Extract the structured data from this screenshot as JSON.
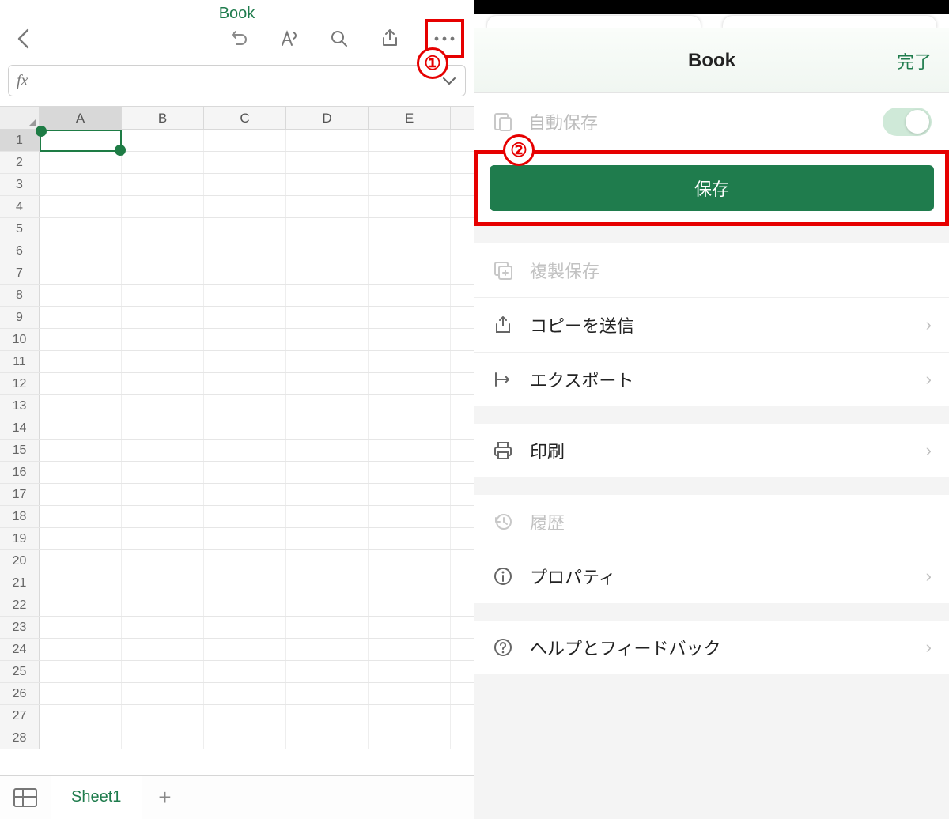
{
  "left": {
    "title": "Book",
    "fx_label": "fx",
    "columns": [
      "A",
      "B",
      "C",
      "D",
      "E"
    ],
    "row_count": 28,
    "selected_cell": "A1",
    "sheet_tab": "Sheet1",
    "annotation1": "①"
  },
  "right": {
    "title": "Book",
    "done": "完了",
    "annotation2": "②",
    "autosave_label": "自動保存",
    "save_button": "保存",
    "items": {
      "duplicate": "複製保存",
      "send_copy": "コピーを送信",
      "export": "エクスポート",
      "print": "印刷",
      "history": "履歴",
      "properties": "プロパティ",
      "help": "ヘルプとフィードバック"
    }
  }
}
